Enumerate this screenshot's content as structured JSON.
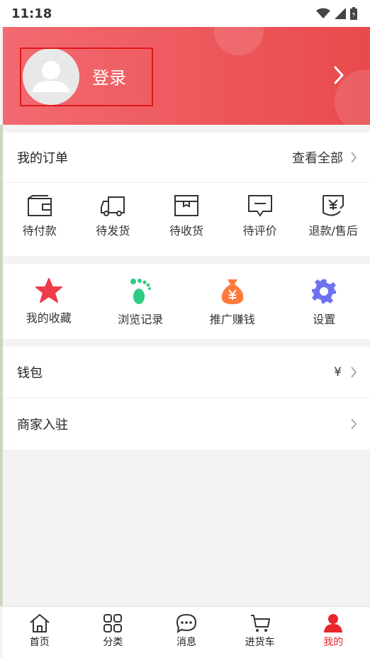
{
  "status_bar": {
    "time": "11:18"
  },
  "header": {
    "login_label": "登录",
    "avatar_icon": "user-avatar-icon"
  },
  "orders": {
    "title": "我的订单",
    "view_all": "查看全部",
    "items": [
      {
        "label": "待付款",
        "icon": "wallet-icon"
      },
      {
        "label": "待发货",
        "icon": "truck-icon"
      },
      {
        "label": "待收货",
        "icon": "package-icon"
      },
      {
        "label": "待评价",
        "icon": "comment-icon"
      },
      {
        "label": "退款/售后",
        "icon": "refund-icon"
      }
    ]
  },
  "tools": [
    {
      "label": "我的收藏",
      "icon": "star-icon",
      "color": "#ef3b4a"
    },
    {
      "label": "浏览记录",
      "icon": "footprint-icon",
      "color": "#2fcc84"
    },
    {
      "label": "推广赚钱",
      "icon": "money-bag-icon",
      "color": "#ff7a3a"
    },
    {
      "label": "设置",
      "icon": "gear-icon",
      "color": "#6d72f0"
    }
  ],
  "list": {
    "wallet": {
      "label": "钱包",
      "value": "¥"
    },
    "merchant": {
      "label": "商家入驻"
    }
  },
  "tabbar": [
    {
      "label": "首页",
      "icon": "home-icon"
    },
    {
      "label": "分类",
      "icon": "grid-icon"
    },
    {
      "label": "消息",
      "icon": "message-icon"
    },
    {
      "label": "进货车",
      "icon": "cart-icon"
    },
    {
      "label": "我的",
      "icon": "person-icon",
      "active": true
    }
  ],
  "colors": {
    "accent": "#e8262b",
    "header_start": "#f26a70",
    "header_end": "#e94a4d"
  }
}
